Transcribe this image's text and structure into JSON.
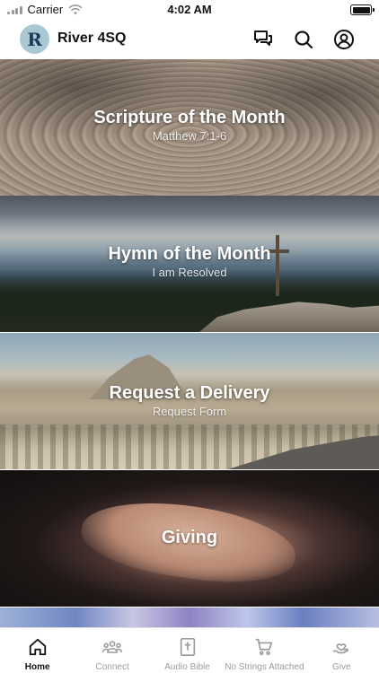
{
  "status_bar": {
    "carrier": "Carrier",
    "time": "4:02 AM"
  },
  "header": {
    "logo_letter": "R",
    "title": "River 4SQ",
    "icons": [
      "chat-icon",
      "search-icon",
      "profile-icon"
    ]
  },
  "cards": [
    {
      "title": "Scripture of the Month",
      "subtitle": "Matthew 7:1-6"
    },
    {
      "title": "Hymn of the Month",
      "subtitle": "I am Resolved"
    },
    {
      "title": "Request a Delivery",
      "subtitle": "Request Form"
    },
    {
      "title": "Giving",
      "subtitle": ""
    }
  ],
  "tabs": [
    {
      "label": "Home",
      "icon": "home-icon",
      "active": true
    },
    {
      "label": "Connect",
      "icon": "group-icon",
      "active": false
    },
    {
      "label": "Audio Bible",
      "icon": "bible-icon",
      "active": false
    },
    {
      "label": "No Strings Attached",
      "icon": "cart-icon",
      "active": false
    },
    {
      "label": "Give",
      "icon": "give-icon",
      "active": false
    }
  ],
  "colors": {
    "active_tab": "#111111",
    "inactive_tab": "#9b9b9b",
    "logo_bg": "#aac7d4",
    "logo_letter": "#1d3a57"
  }
}
